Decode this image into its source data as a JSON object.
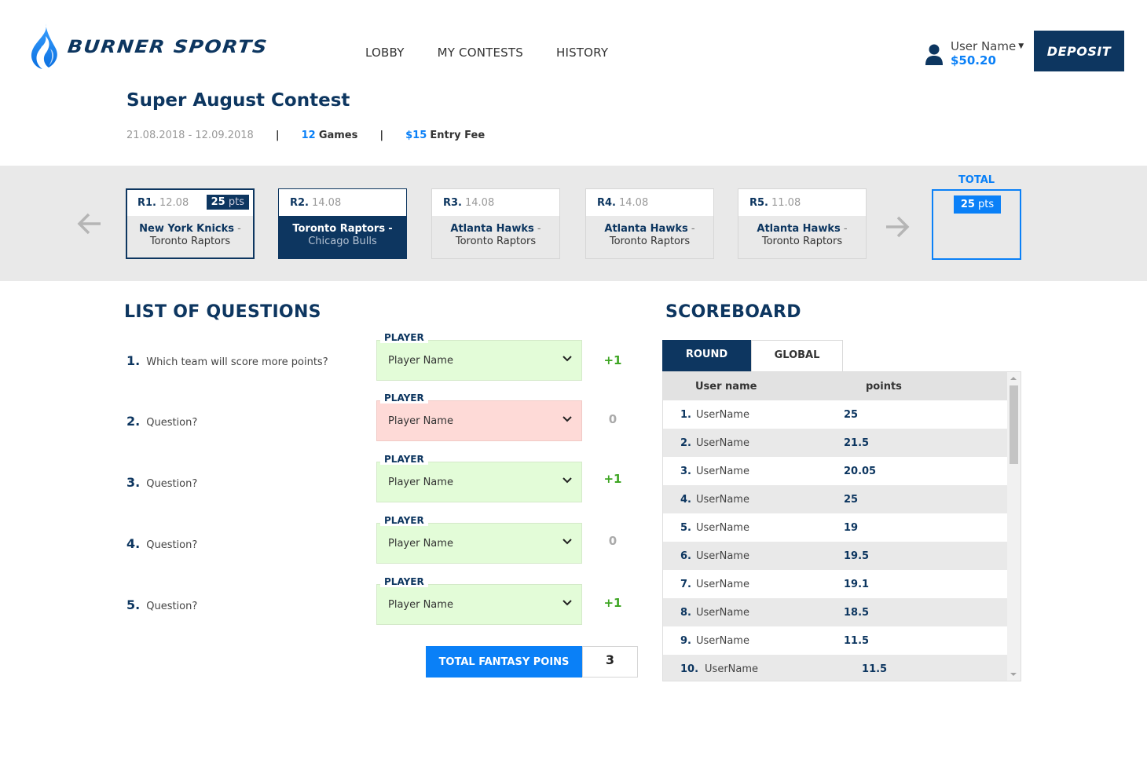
{
  "brand": {
    "name": "BURNER SPORTS"
  },
  "nav": {
    "items": [
      "LOBBY",
      "MY CONTESTS",
      "HISTORY"
    ]
  },
  "user": {
    "name": "User Name",
    "balance": "$50.20",
    "deposit_label": "DEPOSIT"
  },
  "contest": {
    "title": "Super August Contest",
    "dates": "21.08.2018 - 12.09.2018",
    "separator": "|",
    "games_count": "12",
    "games_label": "Games",
    "entry_fee": "$15",
    "entry_fee_label": "Entry Fee"
  },
  "rounds": [
    {
      "label": "R1.",
      "date": "12.08",
      "points": "25",
      "points_unit": "pts",
      "team1": "New York Knicks",
      "team2": "Toronto Raptors",
      "state": "selected"
    },
    {
      "label": "R2.",
      "date": "14.08",
      "team1": "Toronto Raptors",
      "team2": "Chicago Bulls",
      "state": "active"
    },
    {
      "label": "R3.",
      "date": "14.08",
      "team1": "Atlanta Hawks",
      "team2": "Toronto Raptors",
      "state": "default"
    },
    {
      "label": "R4.",
      "date": "14.08",
      "team1": "Atlanta Hawks",
      "team2": "Toronto Raptors",
      "state": "default"
    },
    {
      "label": "R5.",
      "date": "11.08",
      "team1": "Atlanta Hawks",
      "team2": "Toronto Raptors",
      "state": "default"
    }
  ],
  "team_separator": "-",
  "total": {
    "label": "TOTAL",
    "points": "25",
    "points_unit": "pts"
  },
  "questions_section": {
    "title": "LIST OF QUESTIONS",
    "field_label": "PLAYER",
    "items": [
      {
        "num": "1.",
        "text": "Which team will score more points?",
        "value": "Player Name",
        "status": "correct",
        "score": "+1"
      },
      {
        "num": "2.",
        "text": "Question?",
        "value": "Player Name",
        "status": "wrong",
        "score": "0"
      },
      {
        "num": "3.",
        "text": "Question?",
        "value": "Player Name",
        "status": "correct",
        "score": "+1"
      },
      {
        "num": "4.",
        "text": "Question?",
        "value": "Player Name",
        "status": "correct",
        "score": "0"
      },
      {
        "num": "5.",
        "text": "Question?",
        "value": "Player Name",
        "status": "correct",
        "score": "+1"
      }
    ],
    "total_label": "TOTAL FANTASY POINS",
    "total_value": "3"
  },
  "scoreboard": {
    "title": "SCOREBOARD",
    "tabs": [
      "ROUND",
      "GLOBAL"
    ],
    "active_tab": "ROUND",
    "columns": [
      "User name",
      "points"
    ],
    "rows": [
      {
        "rank": "1.",
        "user": "UserName",
        "points": "25"
      },
      {
        "rank": "2.",
        "user": "UserName",
        "points": "21.5"
      },
      {
        "rank": "3.",
        "user": "UserName",
        "points": "20.05"
      },
      {
        "rank": "4.",
        "user": "UserName",
        "points": "25"
      },
      {
        "rank": "5.",
        "user": "UserName",
        "points": "19"
      },
      {
        "rank": "6.",
        "user": "UserName",
        "points": "19.5"
      },
      {
        "rank": "7.",
        "user": "UserName",
        "points": "19.1"
      },
      {
        "rank": "8.",
        "user": "UserName",
        "points": "18.5"
      },
      {
        "rank": "9.",
        "user": "UserName",
        "points": "11.5"
      },
      {
        "rank": "10.",
        "user": "UserName",
        "points": "11.5"
      }
    ]
  },
  "colors": {
    "navy": "#0d3660",
    "accent_blue": "#0a80f7",
    "correct_bg": "#e3fcd8",
    "wrong_bg": "#fedad7",
    "plus_green": "#3fa624"
  }
}
